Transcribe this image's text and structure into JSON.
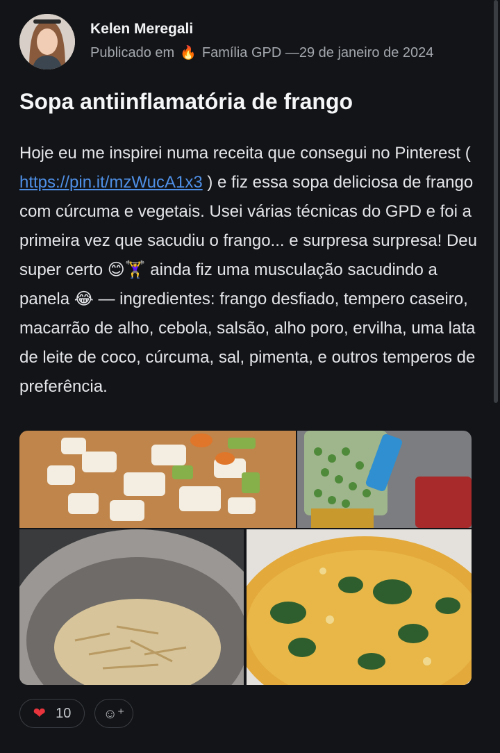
{
  "post": {
    "author": "Kelen Meregali",
    "published_prefix": "Publicado em",
    "community_icon": "fire-emoji",
    "community": "Família GPD —29 de janeiro de 2024",
    "title": "Sopa antiinflamatória de frango",
    "body_before_link": "Hoje eu me inspirei numa receita que consegui no Pinterest ( ",
    "link_text": "https://pin.it/mzWucA1x3",
    "body_after_link": " ) e fiz essa sopa deliciosa de frango com cúrcuma e vegetais. Usei várias técnicas do GPD e foi a primeira vez que sacudiu o frango... e surpresa surpresa! Deu super certo 😊🏋️‍♀️ ainda fiz uma musculação sacudindo a panela 😂 — ingredientes: frango desfiado, tempero caseiro, macarrão de alho, cebola, salsão, alho poro, ervilha, uma lata de leite de coco, cúrcuma, sal, pimenta, e outros temperos de preferência."
  },
  "reactions": {
    "like_icon": "heart-emoji",
    "like_count": "10",
    "add_reaction_icon": "smiley-plus-icon"
  },
  "colors": {
    "background": "#121417",
    "link": "#4f8fe6",
    "heart": "#e8343c"
  }
}
